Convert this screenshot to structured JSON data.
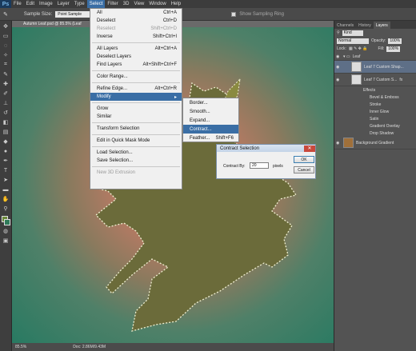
{
  "app": {
    "logo": "Ps"
  },
  "menu": [
    "File",
    "Edit",
    "Image",
    "Layer",
    "Type",
    "Select",
    "Filter",
    "3D",
    "View",
    "Window",
    "Help"
  ],
  "options": {
    "sample_size_label": "Sample Size:",
    "sample_size_value": "Point Sample",
    "show_ring": "Show Sampling Ring"
  },
  "document": {
    "tab": "Autumn Leaf.psd @ 85.5% (Leaf",
    "zoom": "85.5%",
    "doc_info": "Doc: 2.86M/9.43M"
  },
  "select_menu": {
    "g1": [
      {
        "label": "All",
        "shortcut": "Ctrl+A"
      },
      {
        "label": "Deselect",
        "shortcut": "Ctrl+D"
      },
      {
        "label": "Reselect",
        "shortcut": "Shift+Ctrl+D"
      },
      {
        "label": "Inverse",
        "shortcut": "Shift+Ctrl+I"
      }
    ],
    "g2": [
      {
        "label": "All Layers",
        "shortcut": "Alt+Ctrl+A"
      },
      {
        "label": "Deselect Layers",
        "shortcut": ""
      },
      {
        "label": "Find Layers",
        "shortcut": "Alt+Shift+Ctrl+F"
      }
    ],
    "color_range": "Color Range...",
    "refine_edge": {
      "label": "Refine Edge...",
      "shortcut": "Alt+Ctrl+R"
    },
    "modify": "Modify",
    "grow": "Grow",
    "similar": "Similar",
    "transform": "Transform Selection",
    "quickmask": "Edit in Quick Mask Mode",
    "load": "Load Selection...",
    "save": "Save Selection...",
    "extrusion": "New 3D Extrusion"
  },
  "modify_menu": [
    {
      "label": "Border...",
      "shortcut": ""
    },
    {
      "label": "Smooth...",
      "shortcut": ""
    },
    {
      "label": "Expand...",
      "shortcut": ""
    },
    {
      "label": "Contract...",
      "shortcut": ""
    },
    {
      "label": "Feather...",
      "shortcut": "Shift+F6"
    }
  ],
  "dialog": {
    "title": "Contract Selection",
    "label": "Contract By:",
    "value": "20",
    "unit": "pixels",
    "ok": "OK",
    "cancel": "Cancel"
  },
  "panel": {
    "tabs": [
      "Channels",
      "History",
      "Layers"
    ],
    "kind": "Kind",
    "blend": "Normal",
    "opacity_label": "Opacity:",
    "opacity": "100%",
    "lock_label": "Lock:",
    "fill_label": "Fill:",
    "fill": "100%",
    "group": "Leaf",
    "layer1": "Leaf 7 Custom Shap...",
    "layer2": "Leaf 7 Custom S...",
    "effects_label": "Effects",
    "effects": [
      "Bevel & Emboss",
      "Stroke",
      "Inner Glow",
      "Satin",
      "Gradient Overlay",
      "Drop Shadow"
    ],
    "background": "Background Gradient"
  },
  "colors": {
    "leaf": "#6b6b3a",
    "selection": "#3a6ea5"
  }
}
